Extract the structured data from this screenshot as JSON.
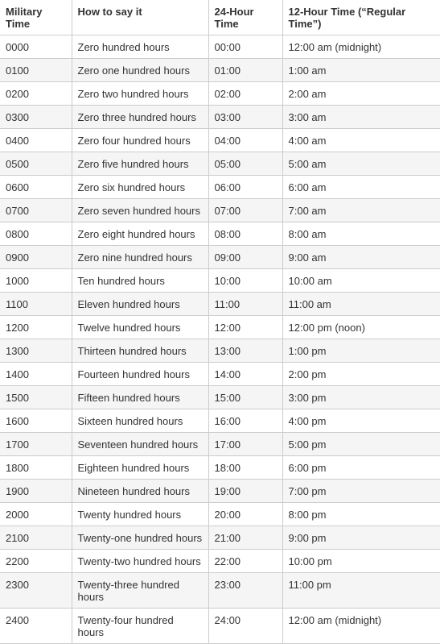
{
  "headers": [
    "Military Time",
    "How to say it",
    "24-Hour Time",
    "12-Hour Time (“Regular Time”)"
  ],
  "rows": [
    [
      "0000",
      "Zero hundred hours",
      "00:00",
      "12:00 am (midnight)"
    ],
    [
      "0100",
      "Zero one hundred hours",
      "01:00",
      "1:00 am"
    ],
    [
      "0200",
      "Zero two hundred hours",
      "02:00",
      "2:00 am"
    ],
    [
      "0300",
      "Zero three hundred hours",
      "03:00",
      "3:00 am"
    ],
    [
      "0400",
      "Zero four hundred hours",
      "04:00",
      "4:00 am"
    ],
    [
      "0500",
      "Zero five hundred hours",
      "05:00",
      "5:00 am"
    ],
    [
      "0600",
      "Zero six hundred hours",
      "06:00",
      "6:00 am"
    ],
    [
      "0700",
      "Zero seven hundred hours",
      "07:00",
      "7:00 am"
    ],
    [
      "0800",
      "Zero eight hundred hours",
      "08:00",
      "8:00 am"
    ],
    [
      "0900",
      "Zero nine hundred hours",
      "09:00",
      "9:00 am"
    ],
    [
      "1000",
      "Ten hundred hours",
      "10:00",
      "10:00 am"
    ],
    [
      "1100",
      "Eleven hundred hours",
      "11:00",
      "11:00 am"
    ],
    [
      "1200",
      "Twelve hundred hours",
      "12:00",
      "12:00 pm (noon)"
    ],
    [
      "1300",
      "Thirteen hundred hours",
      "13:00",
      "1:00 pm"
    ],
    [
      "1400",
      "Fourteen hundred hours",
      "14:00",
      "2:00 pm"
    ],
    [
      "1500",
      "Fifteen hundred hours",
      "15:00",
      "3:00 pm"
    ],
    [
      "1600",
      "Sixteen hundred hours",
      "16:00",
      "4:00 pm"
    ],
    [
      "1700",
      "Seventeen hundred hours",
      "17:00",
      "5:00 pm"
    ],
    [
      "1800",
      "Eighteen hundred hours",
      "18:00",
      "6:00 pm"
    ],
    [
      "1900",
      "Nineteen hundred hours",
      "19:00",
      "7:00 pm"
    ],
    [
      "2000",
      "Twenty hundred hours",
      "20:00",
      "8:00 pm"
    ],
    [
      "2100",
      "Twenty-one hundred hours",
      "21:00",
      "9:00 pm"
    ],
    [
      "2200",
      "Twenty-two hundred hours",
      "22:00",
      "10:00 pm"
    ],
    [
      "2300",
      "Twenty-three hundred hours",
      "23:00",
      "11:00 pm"
    ],
    [
      "2400",
      "Twenty-four hundred hours",
      "24:00",
      "12:00 am (midnight)"
    ]
  ]
}
